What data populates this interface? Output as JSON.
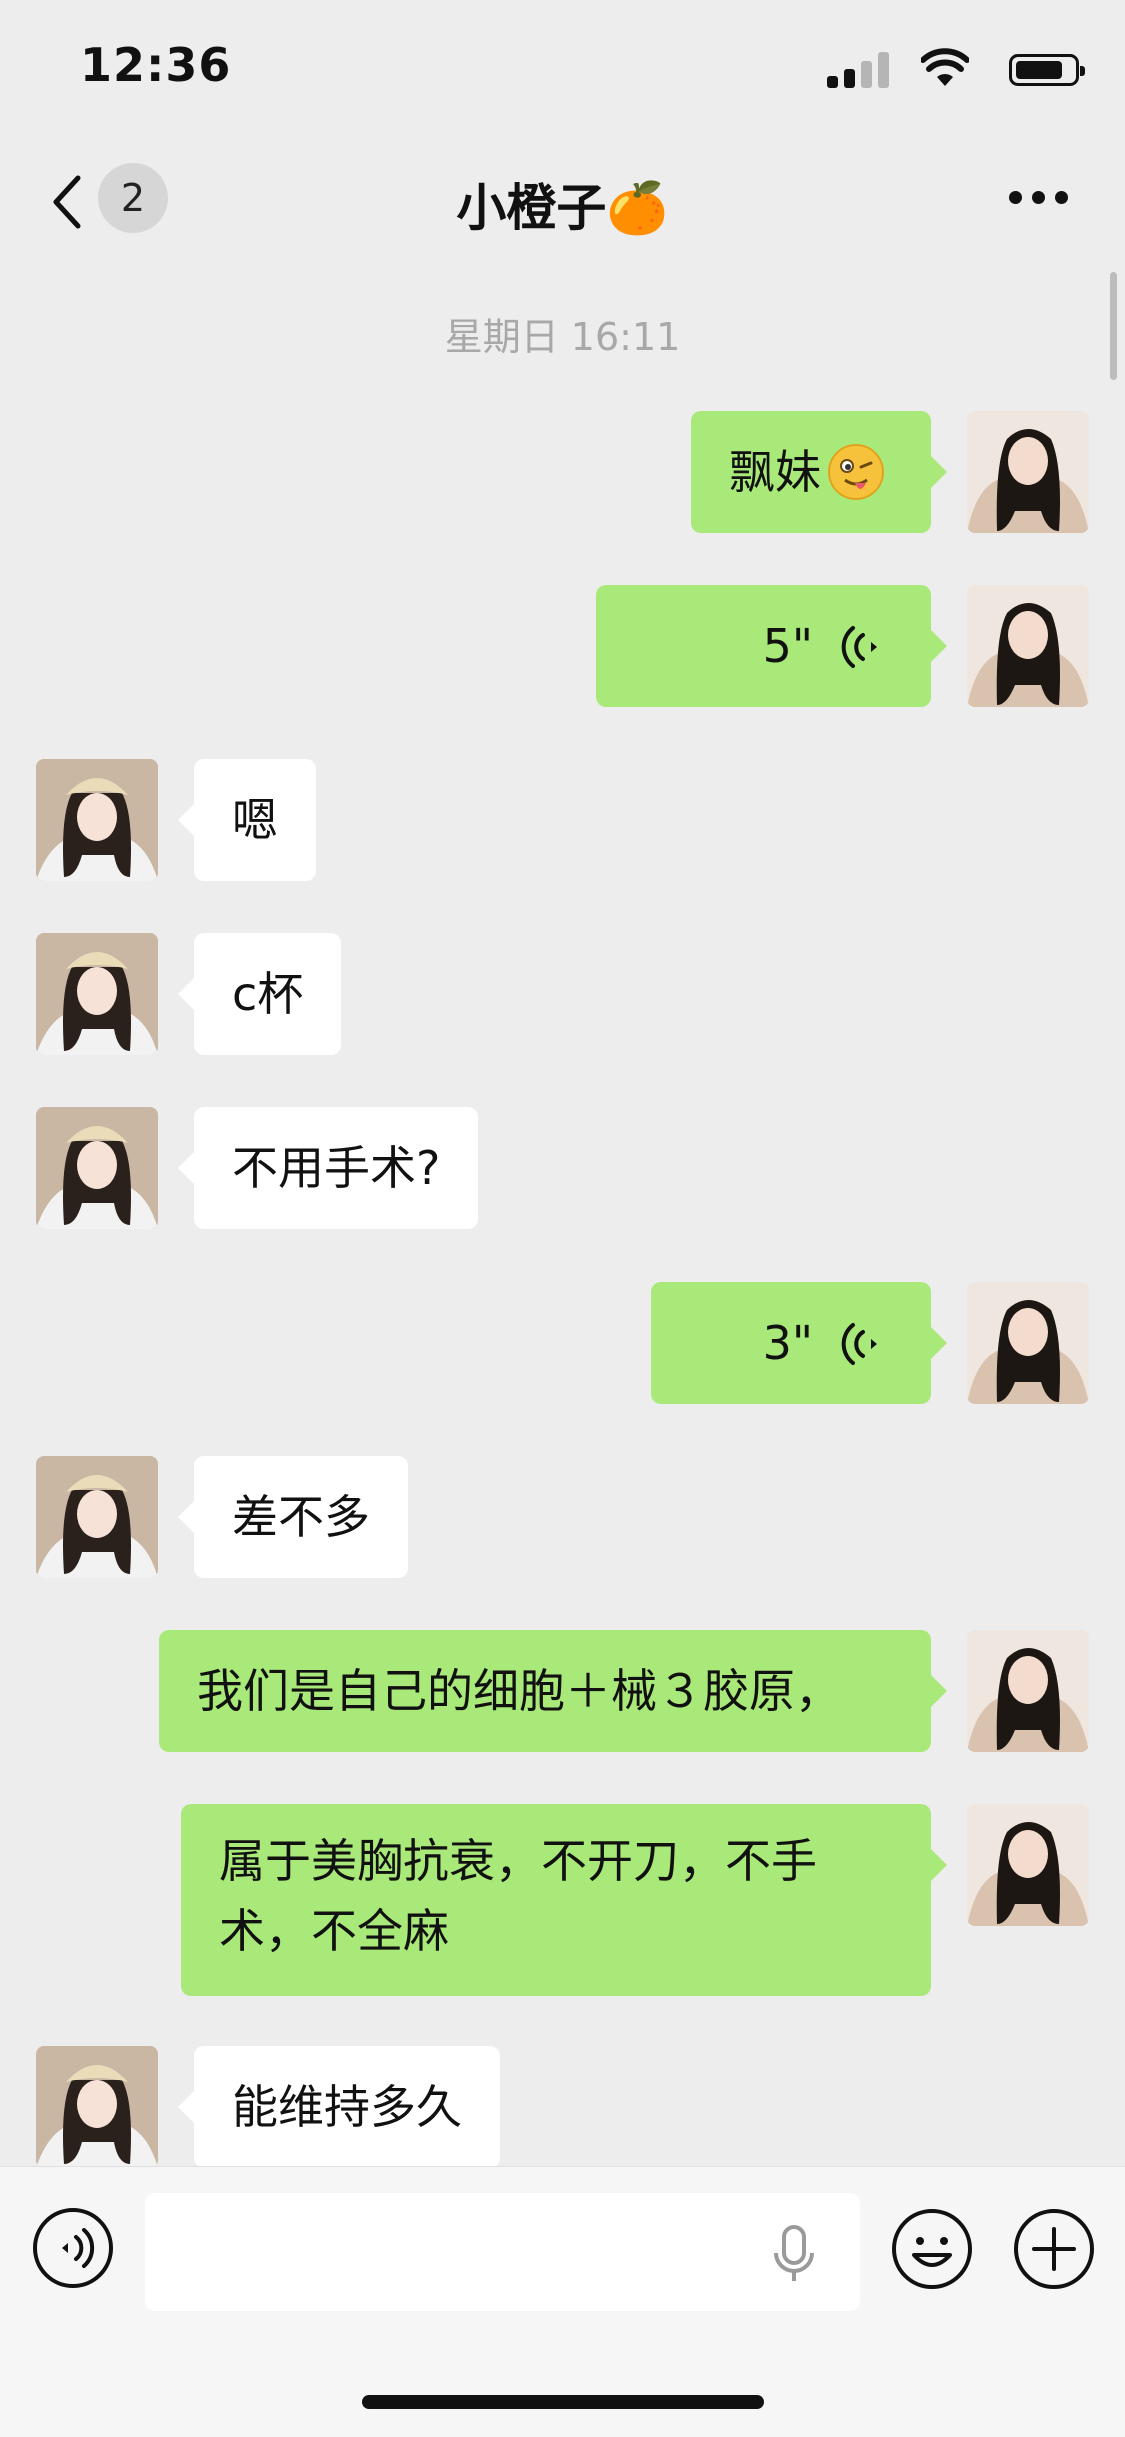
{
  "status_bar": {
    "time": "12:36"
  },
  "nav": {
    "unread_count": "2",
    "title": "小橙子🍊"
  },
  "chat": {
    "timestamp": "星期日 16:11",
    "messages": [
      {
        "from": "me",
        "type": "text",
        "text": "飘妹"
      },
      {
        "from": "me",
        "type": "voice",
        "duration": "5\""
      },
      {
        "from": "her",
        "type": "text",
        "text": "嗯"
      },
      {
        "from": "her",
        "type": "text",
        "text": "c杯"
      },
      {
        "from": "her",
        "type": "text",
        "text": "不用手术?"
      },
      {
        "from": "me",
        "type": "voice",
        "duration": "3\""
      },
      {
        "from": "her",
        "type": "text",
        "text": "差不多"
      },
      {
        "from": "me",
        "type": "text",
        "text": "我们是自己的细胞＋械３胶原，"
      },
      {
        "from": "me",
        "type": "text",
        "text": "属于美胸抗衰，不开刀，不手术，不全麻"
      },
      {
        "from": "her",
        "type": "text",
        "text": "能维持多久"
      }
    ]
  },
  "input": {
    "value": ""
  },
  "icons": {
    "back": "chevron-left-icon",
    "more": "more-dots-icon",
    "voice_toggle": "voice-mode-icon",
    "mic": "microphone-icon",
    "emoji": "smiley-icon",
    "plus": "plus-circle-icon"
  },
  "colors": {
    "background": "#ededed",
    "outgoing_bubble": "#a9e979",
    "incoming_bubble": "#ffffff"
  }
}
